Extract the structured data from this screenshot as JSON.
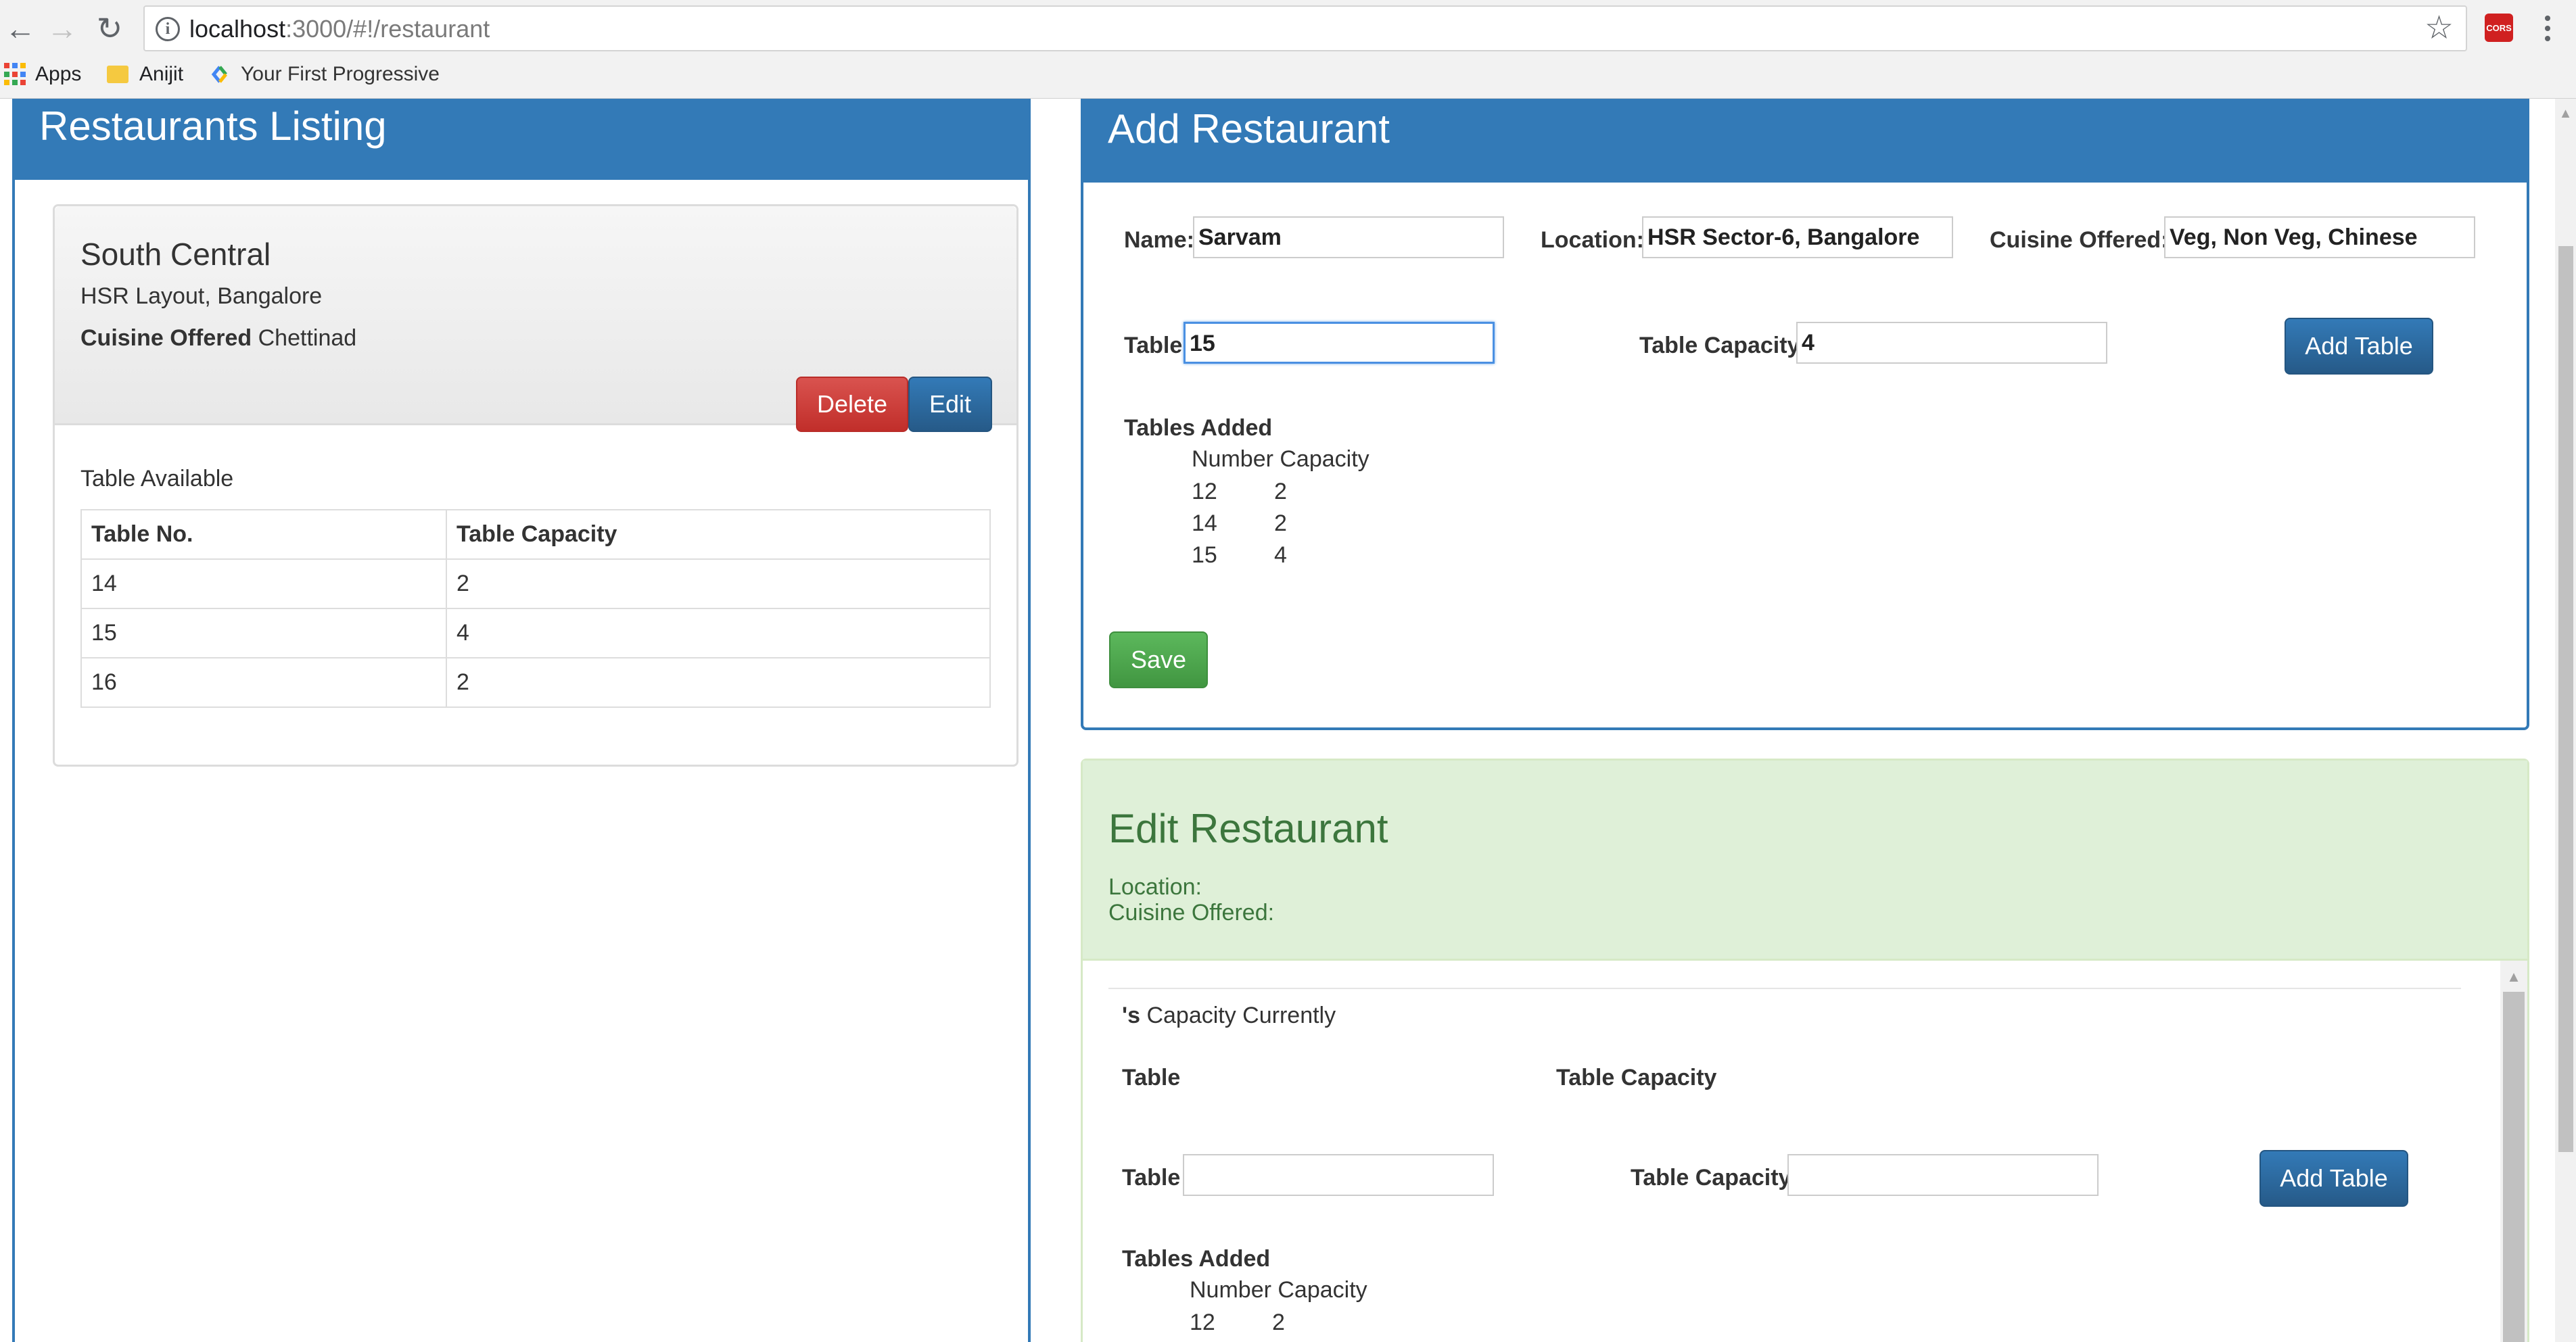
{
  "browser": {
    "url_host": "localhost",
    "url_path": ":3000/#!/restaurant",
    "bookmarks": [
      "Apps",
      "Anijit",
      "Your First Progressive"
    ],
    "extension_badge": "CORS"
  },
  "left_panel": {
    "title": "Restaurants Listing",
    "restaurant": {
      "name": "South Central",
      "location": "HSR Layout, Bangalore",
      "cuisine_label": "Cuisine Offered",
      "cuisine_value": "Chettinad",
      "delete_label": "Delete",
      "edit_label": "Edit",
      "tables_label": "Table Available",
      "table_headers": [
        "Table No.",
        "Table Capacity"
      ],
      "tables": [
        {
          "number": "14",
          "capacity": "2"
        },
        {
          "number": "15",
          "capacity": "4"
        },
        {
          "number": "16",
          "capacity": "2"
        }
      ]
    }
  },
  "add_panel": {
    "title": "Add Restaurant",
    "name_label": "Name:",
    "name_value": "Sarvam",
    "location_label": "Location:",
    "location_value": "HSR Sector-6, Bangalore",
    "cuisine_label": "Cuisine Offered:",
    "cuisine_value": "Veg, Non Veg, Chinese",
    "table_label": "Table",
    "table_value": "15",
    "capacity_label": "Table Capacity",
    "capacity_value": "4",
    "add_table_label": "Add Table",
    "tables_added_label": "Tables Added",
    "tables_added_header": "Number Capacity",
    "tables_added": [
      {
        "number": "12",
        "capacity": "2"
      },
      {
        "number": "14",
        "capacity": "2"
      },
      {
        "number": "15",
        "capacity": "4"
      }
    ],
    "save_label": "Save"
  },
  "edit_panel": {
    "title": "Edit Restaurant",
    "location_label": "Location:",
    "cuisine_label": "Cuisine Offered:",
    "capacity_prefix": "'s",
    "capacity_text": " Capacity Currently",
    "table_header": "Table",
    "capacity_header": "Table Capacity",
    "table_label": "Table",
    "capacity_label": "Table Capacity",
    "add_table_label": "Add Table",
    "tables_added_label": "Tables Added",
    "tables_added_header": "Number Capacity",
    "tables_added": [
      {
        "number": "12",
        "capacity": "2"
      }
    ]
  },
  "colors": {
    "primary": "#337ab7",
    "danger": "#d9534f",
    "success": "#5cb85c",
    "edit_heading_bg": "#dff0d8",
    "edit_heading_text": "#3c763d"
  }
}
